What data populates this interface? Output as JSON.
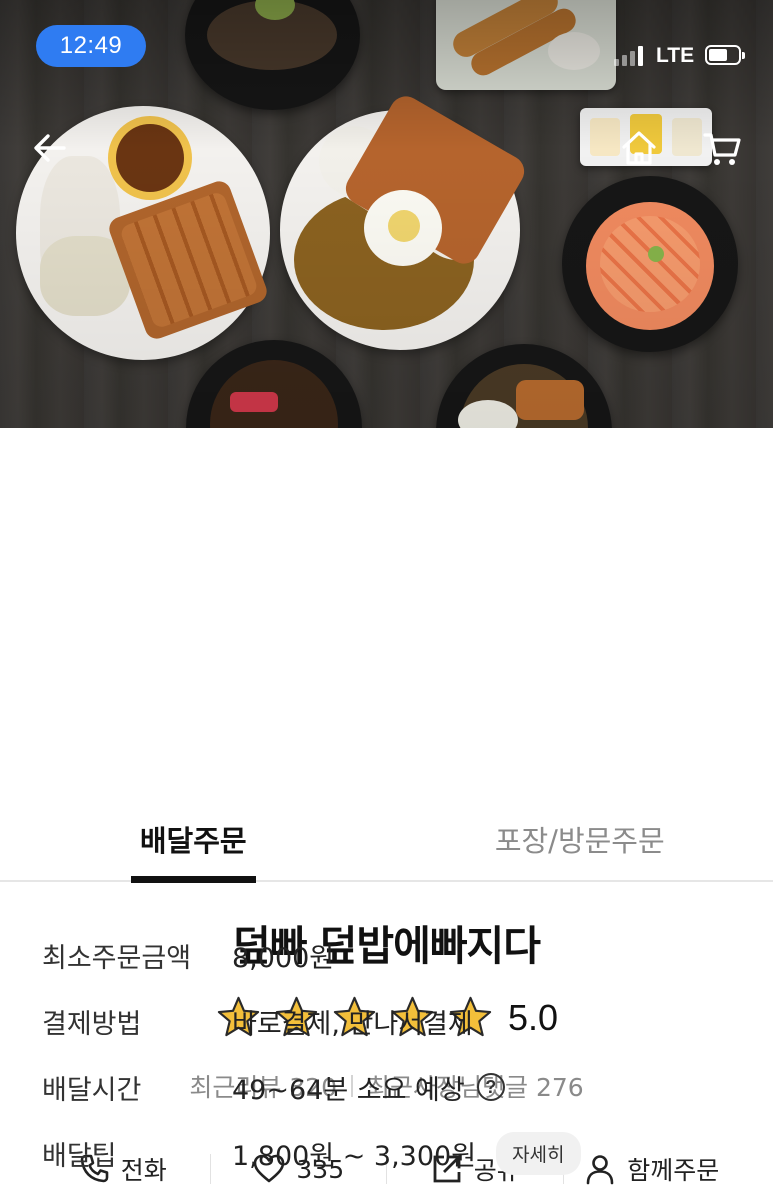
{
  "status_bar": {
    "time": "12:49",
    "network": "LTE"
  },
  "hero": {
    "icons": [
      "back-arrow-icon",
      "home-icon",
      "cart-icon"
    ]
  },
  "store": {
    "name": "덮빠 덮밥에빠지다",
    "rating_stars": 5,
    "rating_value": "5.0",
    "recent_reviews_label": "최근리뷰 320",
    "recent_owner_replies_label": "최근사장님댓글 276"
  },
  "actions": {
    "call": "전화",
    "favorite_count": "335",
    "share": "공유",
    "group_order": "함께주문"
  },
  "tabs": [
    {
      "label": "배달주문",
      "active": true
    },
    {
      "label": "포장/방문주문",
      "active": false
    }
  ],
  "info": {
    "min_order": {
      "label": "최소주문금액",
      "value": "8,000원"
    },
    "payment": {
      "label": "결제방법",
      "value": "바로결제, 만나서결제"
    },
    "delivery_time": {
      "label": "배달시간",
      "value": "49~64분 소요 예상",
      "help": "?"
    },
    "delivery_tip": {
      "label": "배달팁",
      "value": "1,800원 ~ 3,300원",
      "detail": "자세히"
    }
  },
  "colors": {
    "time_pill": "#2f7cf2",
    "star_fill": "#f3bf3a",
    "star_stroke": "#2a2a2a",
    "text_primary": "#111111",
    "text_muted": "#8a8a8a"
  }
}
